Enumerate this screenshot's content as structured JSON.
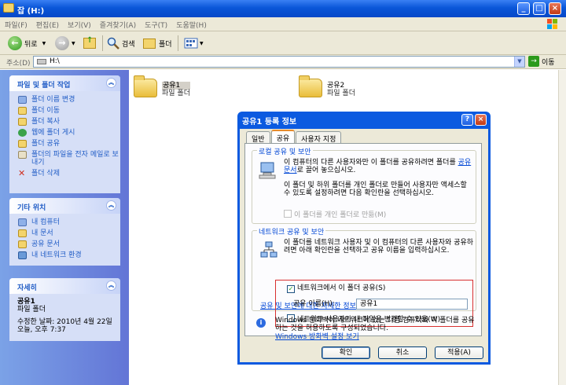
{
  "window": {
    "title": "잡 (H:)"
  },
  "menu": [
    "파일(F)",
    "편집(E)",
    "보기(V)",
    "즐겨찾기(A)",
    "도구(T)",
    "도움말(H)"
  ],
  "toolbar": {
    "back": "뒤로",
    "search": "검색",
    "folders": "폴더"
  },
  "address": {
    "label": "주소(D)",
    "value": "H:\\",
    "go": "이동"
  },
  "tasks": {
    "title": "파일 및 폴더 작업",
    "items": [
      "폴더 이름 변경",
      "폴더 이동",
      "폴더 복사",
      "웹에 폴더 게시",
      "폴더 공유",
      "폴더의 파일을 전자 메일로 보내기",
      "폴더 삭제"
    ]
  },
  "other_places": {
    "title": "기타 위치",
    "items": [
      "내 컴퓨터",
      "내 문서",
      "공유 문서",
      "내 네트워크 환경"
    ]
  },
  "details": {
    "title": "자세히",
    "name": "공유1",
    "type": "파일 폴더",
    "modified": "수정한 날짜: 2010년 4월 22일 오늘, 오후 7:37"
  },
  "files": [
    {
      "name": "공유1",
      "type": "파일 폴더"
    },
    {
      "name": "공유2",
      "type": "파일 폴더"
    }
  ],
  "dialog": {
    "title": "공유1 등록 정보",
    "tabs": [
      "일반",
      "공유",
      "사용자 지정"
    ],
    "local": {
      "label": "로컬 공유 및 보안",
      "text1": "이 컴퓨터의 다른 사용자와만 이 폴더를 공유하려면 폴더를",
      "text1_link": "공유 문서",
      "text1_rest": "로 끌어 놓으십시오.",
      "text2": "이 폴더 및 하위 폴더를 개인 폴더로 만들어 사용자만 액세스할 수 있도록 설정하려면 다음 확인란을 선택하십시오.",
      "private_checkbox": "이 폴더를 개인 폴더로 만듦(M)"
    },
    "network": {
      "label": "네트워크 공유 및 보안",
      "text": "이 폴더를 네트워크 사용자 및 이 컴퓨터의 다른 사용자와 공유하려면 아래 확인란을 선택하고 공유 이름을 입력하십시오.",
      "share_checkbox": "네트워크에서 이 폴더 공유(S)",
      "share_name_label": "공유 이름(H):",
      "share_name_value": "공유1",
      "allow_change_checkbox": "네트워크 사용자가 내 파일을 변경할 수 있음(W)",
      "link": "공유 및 보안에 대한 자세한 정보"
    },
    "firewall": {
      "text": "Windows 방화벽이 네트워크에 있는 다른 컴퓨터와 이 폴더를 공유하는 것을 허용하도록 구성되었습니다.",
      "link": "Windows 방화벽 설정 보기"
    },
    "buttons": {
      "ok": "확인",
      "cancel": "취소",
      "apply": "적용(A)"
    }
  }
}
